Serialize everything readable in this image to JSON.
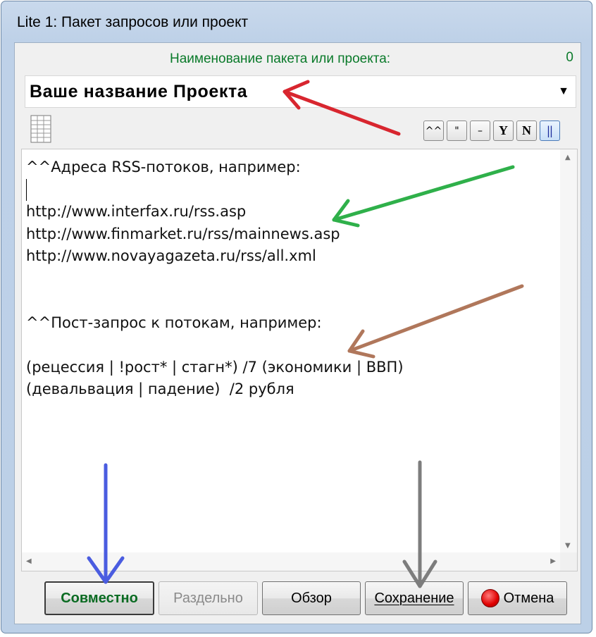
{
  "window": {
    "title": "Lite 1: Пакет запросов или проект"
  },
  "name": {
    "label": "Наименование пакета или проекта:",
    "counter": "0",
    "value": "Ваше название Проекта"
  },
  "toolbar": {
    "buttons": [
      {
        "label": "^^",
        "icon": "caret-caret"
      },
      {
        "label": "\"",
        "icon": "quote"
      },
      {
        "label": "–",
        "icon": "dash"
      },
      {
        "label": "Y",
        "icon": "letter-y"
      },
      {
        "label": "N",
        "icon": "letter-n"
      },
      {
        "label": "||",
        "icon": "double-bar"
      }
    ]
  },
  "editor": {
    "lines": [
      "^^Адреса RSS-потоков, например:",
      "",
      "http://www.interfax.ru/rss.asp",
      "http://www.finmarket.ru/rss/mainnews.asp",
      "http://www.novayagazeta.ru/rss/all.xml",
      "",
      "",
      "^^Пост-запрос к потокам, например:",
      "",
      "(рецессия | !рост* | стагн*) /7 (экономики | ВВП)",
      "(девальвация | падение)  /2 рубля"
    ]
  },
  "buttons": {
    "together": "Совместно",
    "separately": "Раздельно",
    "browse": "Обзор",
    "save": "Сохранение",
    "cancel": "Отмена"
  },
  "annotation_colors": {
    "red": "#d8262f",
    "green": "#2fb04a",
    "brown": "#b0775b",
    "blue": "#4a5ce0",
    "gray": "#7d7d7d"
  }
}
